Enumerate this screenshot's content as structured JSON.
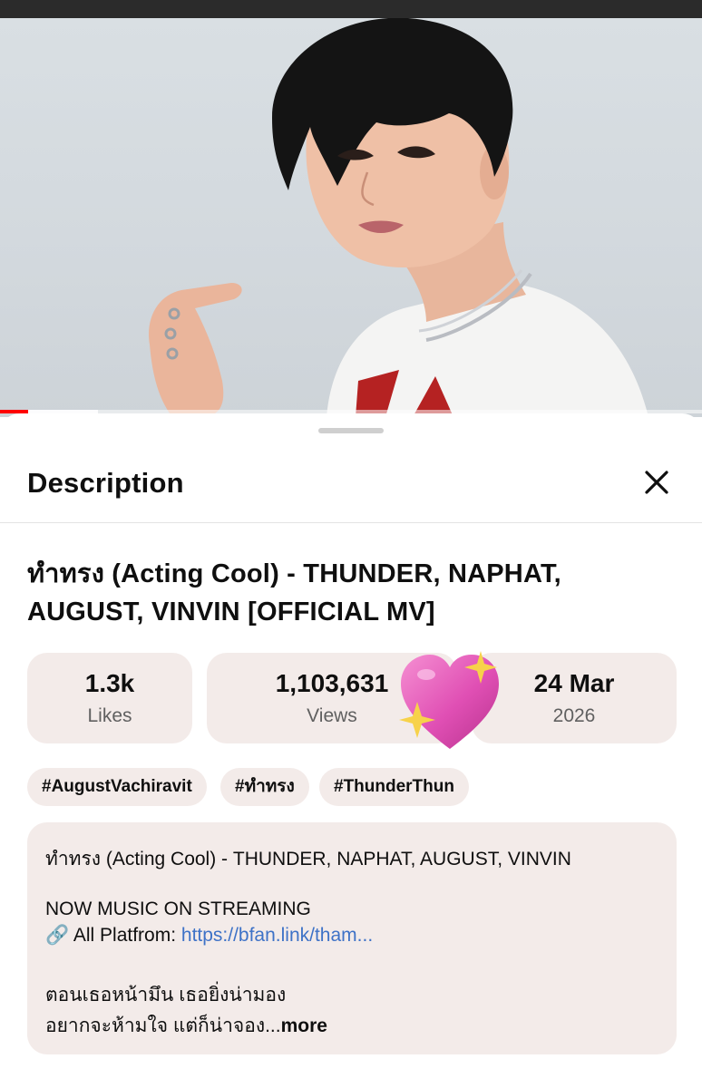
{
  "colors": {
    "accent": "#ff0000",
    "link": "#3e72c7",
    "chip_bg": "#f3ebe9"
  },
  "video": {
    "progress_fraction": 0.04
  },
  "sheet": {
    "title": "Description"
  },
  "video_title": "ทำทรง (Acting Cool) - THUNDER, NAPHAT, AUGUST, VINVIN [OFFICIAL MV]",
  "stats": {
    "likes": {
      "value": "1.3k",
      "label": "Likes"
    },
    "views": {
      "value": "1,103,631",
      "label": "Views"
    },
    "date": {
      "value": "24 Mar",
      "label": "2026"
    }
  },
  "tags": [
    "#AugustVachiravit",
    "#ทำทรง",
    "#ThunderThun"
  ],
  "description": {
    "line1": "ทำทรง (Acting Cool) - THUNDER, NAPHAT, AUGUST, VINVIN",
    "line2": "NOW MUSIC ON STREAMING",
    "link_icon": "🔗",
    "link_prefix": "All Platfrom:",
    "link_text": "https://bfan.link/tham...",
    "line4": "ตอนเธอหน้ามึน เธอยิ่งน่ามอง",
    "line5": "อยากจะห้ามใจ แต่ก็น่าจอง...",
    "more_label": "more"
  },
  "icons": {
    "close": "close-icon",
    "heart": "sparkling-heart-icon",
    "link": "link-icon"
  }
}
